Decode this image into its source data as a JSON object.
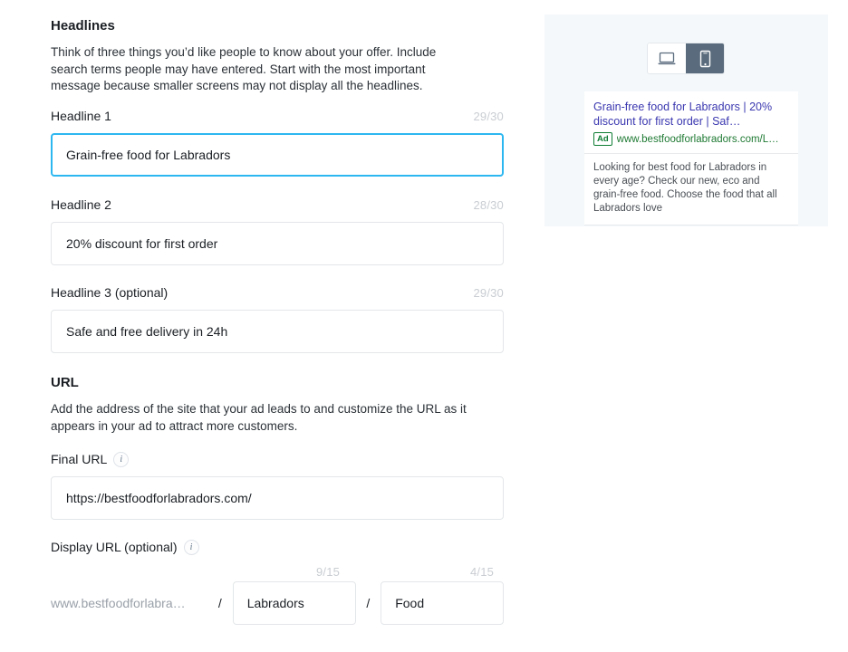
{
  "headlines_section": {
    "title": "Headlines",
    "description": "Think of three things you’d like people to know about your offer. Include search terms people may have entered. Start with the most important message because smaller screens may not display all the headlines.",
    "fields": [
      {
        "label": "Headline 1",
        "counter": "29/30",
        "value": "Grain-free food for Labradors",
        "focused": true
      },
      {
        "label": "Headline 2",
        "counter": "28/30",
        "value": "20% discount for first order",
        "focused": false
      },
      {
        "label": "Headline 3 (optional)",
        "counter": "29/30",
        "value": "Safe and free delivery in 24h",
        "focused": false
      }
    ]
  },
  "url_section": {
    "title": "URL",
    "description": "Add the address of the site that your ad leads to and customize the URL as it appears in your ad to attract more customers.",
    "final_url": {
      "label": "Final URL",
      "info_icon": "info-icon",
      "value": "https://bestfoodforlabradors.com/"
    },
    "display_url": {
      "label": "Display URL (optional)",
      "info_icon": "info-icon",
      "domain_prefix": "www.bestfoodforlabra…",
      "separator": "/",
      "path1": {
        "value": "Labradors",
        "counter": "9/15"
      },
      "path2": {
        "value": "Food",
        "counter": "4/15"
      }
    }
  },
  "preview": {
    "device_toggle": {
      "desktop": {
        "icon": "desktop-monitor-icon",
        "active": false
      },
      "mobile": {
        "icon": "mobile-phone-icon",
        "active": true
      }
    },
    "ad": {
      "title": "Grain-free food for Labradors | 20% discount for first order | Saf…",
      "badge": "Ad",
      "url": "www.bestfoodforlabradors.com/L…",
      "description": "Looking for best food for Labradors in every age? Check our new, eco and grain-free food. Choose the food that all Labradors love"
    }
  },
  "colors": {
    "focus_border": "#2db7f0",
    "ad_title": "#3b38b0",
    "ad_url_green": "#1f7a33",
    "panel_bg": "#f4f8fa",
    "toggle_active": "#5a6b7d"
  }
}
